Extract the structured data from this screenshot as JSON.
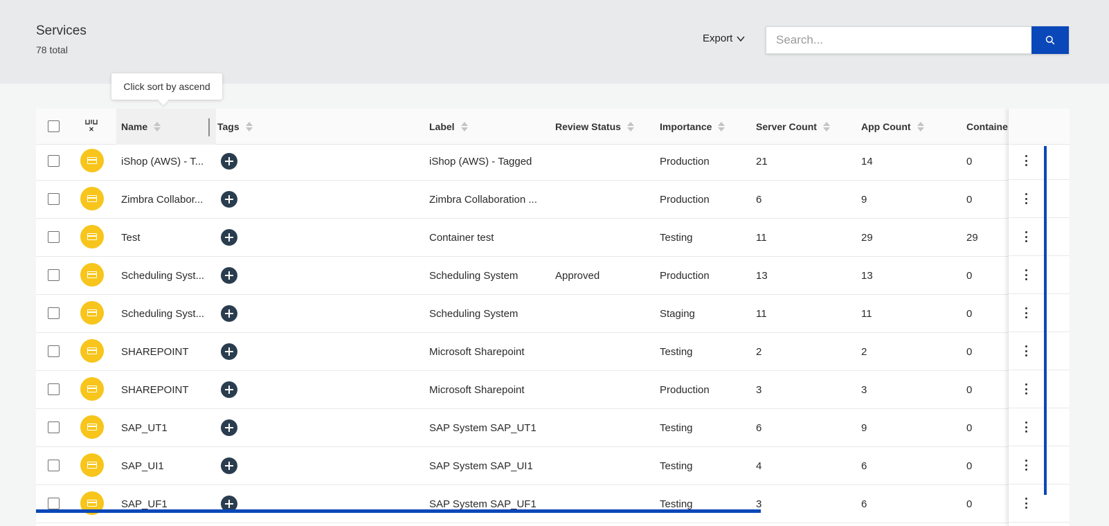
{
  "header": {
    "title": "Services",
    "subtitle": "78 total",
    "export_label": "Export",
    "search_placeholder": "Search...",
    "accent_color": "#0a47b8"
  },
  "tooltip": {
    "text": "Click sort by ascend"
  },
  "table": {
    "columns": {
      "name": "Name",
      "tags": "Tags",
      "label": "Label",
      "review_status": "Review Status",
      "importance": "Importance",
      "server_count": "Server Count",
      "app_count": "App Count",
      "container": "Containe"
    },
    "rows": [
      {
        "name": "iShop (AWS) - T...",
        "label": "iShop (AWS) - Tagged",
        "review_status": "",
        "importance": "Production",
        "server_count": "21",
        "app_count": "14",
        "container": "0"
      },
      {
        "name": "Zimbra Collabor...",
        "label": "Zimbra Collaboration ...",
        "review_status": "",
        "importance": "Production",
        "server_count": "6",
        "app_count": "9",
        "container": "0"
      },
      {
        "name": "Test",
        "label": "Container test",
        "review_status": "",
        "importance": "Testing",
        "server_count": "11",
        "app_count": "29",
        "container": "29"
      },
      {
        "name": "Scheduling Syst...",
        "label": "Scheduling System",
        "review_status": "Approved",
        "importance": "Production",
        "server_count": "13",
        "app_count": "13",
        "container": "0"
      },
      {
        "name": "Scheduling Syst...",
        "label": "Scheduling System",
        "review_status": "",
        "importance": "Staging",
        "server_count": "11",
        "app_count": "11",
        "container": "0"
      },
      {
        "name": "SHAREPOINT",
        "label": "Microsoft Sharepoint",
        "review_status": "",
        "importance": "Testing",
        "server_count": "2",
        "app_count": "2",
        "container": "0"
      },
      {
        "name": "SHAREPOINT",
        "label": "Microsoft Sharepoint",
        "review_status": "",
        "importance": "Production",
        "server_count": "3",
        "app_count": "3",
        "container": "0"
      },
      {
        "name": "SAP_UT1",
        "label": "SAP System SAP_UT1",
        "review_status": "",
        "importance": "Testing",
        "server_count": "6",
        "app_count": "9",
        "container": "0"
      },
      {
        "name": "SAP_UI1",
        "label": "SAP System SAP_UI1",
        "review_status": "",
        "importance": "Testing",
        "server_count": "4",
        "app_count": "6",
        "container": "0"
      },
      {
        "name": "SAP_UF1",
        "label": "SAP System SAP_UF1",
        "review_status": "",
        "importance": "Testing",
        "server_count": "3",
        "app_count": "6",
        "container": "0"
      }
    ]
  }
}
